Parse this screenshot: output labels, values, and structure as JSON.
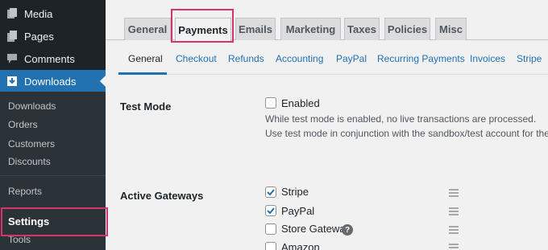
{
  "sidebar": {
    "items": [
      {
        "label": "Media",
        "icon": "media-icon"
      },
      {
        "label": "Pages",
        "icon": "pages-icon"
      },
      {
        "label": "Comments",
        "icon": "comments-icon"
      },
      {
        "label": "Downloads",
        "icon": "download-icon"
      }
    ],
    "submenu": [
      "Downloads",
      "Orders",
      "Customers",
      "Discounts",
      "Reports",
      "Settings",
      "Tools"
    ]
  },
  "tabs": [
    "General",
    "Payments",
    "Emails",
    "Marketing",
    "Taxes",
    "Policies",
    "Misc"
  ],
  "subtabs": [
    "General",
    "Checkout",
    "Refunds",
    "Accounting",
    "PayPal",
    "Recurring Payments",
    "Invoices",
    "Stripe"
  ],
  "test_mode": {
    "label": "Test Mode",
    "checkbox_label": "Enabled",
    "desc1": "While test mode is enabled, no live transactions are processed.",
    "desc2": "Use test mode in conjunction with the sandbox/test account for the p"
  },
  "gateways": {
    "label": "Active Gateways",
    "items": [
      {
        "label": "Stripe",
        "checked": true
      },
      {
        "label": "PayPal",
        "checked": true
      },
      {
        "label": "Store Gateway",
        "checked": false
      },
      {
        "label": "Amazon",
        "checked": false
      }
    ]
  },
  "colors": {
    "accent": "#2271b1",
    "highlight": "#d6336c",
    "sidebar": "#1d2327"
  }
}
